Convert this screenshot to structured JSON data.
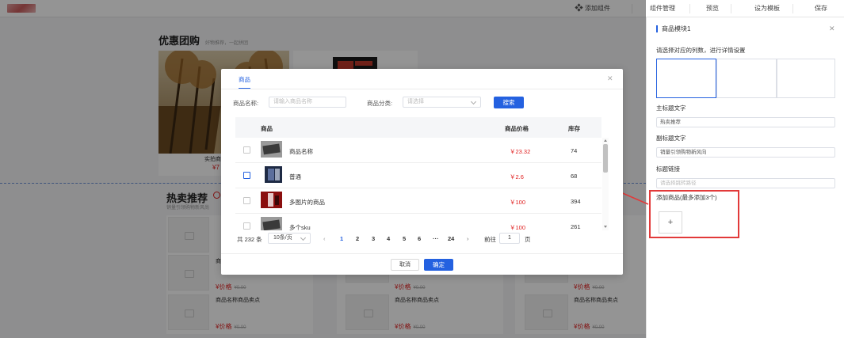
{
  "topbar": {
    "add_component": "添加组件",
    "component_manage": "组件管理",
    "preview": "预览",
    "set_template": "设为模板",
    "save": "保存"
  },
  "canvas": {
    "section1": {
      "title": "优惠团购",
      "subtitle": "好物推荐，一起拼团",
      "item_name": "实拍商",
      "item_price": "¥7"
    },
    "section2": {
      "title": "热卖推荐",
      "subtitle": "销量引领购物新风尚"
    },
    "price_label": "¥价格",
    "orig_price": "¥0.00",
    "product_name": "商品名称商品卖点",
    "left_name": "商"
  },
  "panel": {
    "title": "商品模块1",
    "hint": "请选择对应的列数，进行详情设置",
    "main_title_label": "主标题文字",
    "main_title_value": "热卖推荐",
    "sub_title_label": "副标题文字",
    "sub_title_value": "销量引领购物新风向",
    "link_label": "标题链接",
    "link_placeholder": "请选择跳转路径",
    "add_product_label": "添加商品(最多添加3个)",
    "add_btn": "+"
  },
  "modal": {
    "tab": "商品",
    "name_label": "商品名称:",
    "name_placeholder": "请输入商品名称",
    "cat_label": "商品分类:",
    "cat_placeholder": "请选择",
    "search_btn": "搜索",
    "columns": {
      "product": "商品",
      "price": "商品价格",
      "stock": "库存"
    },
    "rows": [
      {
        "name": "商品名称",
        "price": "￥23.32",
        "stock": "74"
      },
      {
        "name": "普通",
        "price": "￥2.6",
        "stock": "68"
      },
      {
        "name": "多图片的商品",
        "price": "￥100",
        "stock": "394"
      },
      {
        "name": "多个sku",
        "price": "￥100",
        "stock": "261"
      }
    ],
    "pagination": {
      "total": "共 232 条",
      "page_size": "10条/页",
      "prev": "‹",
      "pages": [
        "1",
        "2",
        "3",
        "4",
        "5",
        "6",
        "···",
        "24"
      ],
      "next": "›",
      "goto": "前往",
      "goto_value": "1",
      "page_unit": "页"
    },
    "cancel_btn": "取消",
    "confirm_btn": "确定"
  },
  "colors": {
    "accent": "#2461e0",
    "price": "#e02020",
    "annotation": "#e23a3a"
  }
}
